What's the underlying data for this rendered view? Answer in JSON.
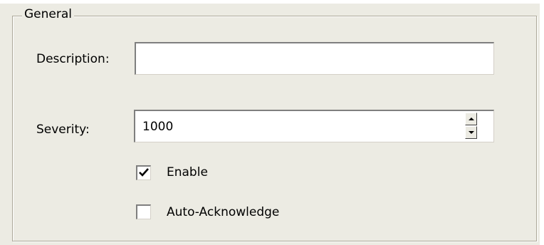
{
  "group": {
    "title": "General"
  },
  "description": {
    "label": "Description:",
    "value": ""
  },
  "severity": {
    "label": "Severity:",
    "value": "1000"
  },
  "enable": {
    "label": "Enable",
    "checked": true
  },
  "auto_ack": {
    "label": "Auto-Acknowledge",
    "checked": false
  },
  "icons": {
    "spin_up": "spin-up-arrow",
    "spin_down": "spin-down-arrow",
    "check": "checkmark"
  }
}
